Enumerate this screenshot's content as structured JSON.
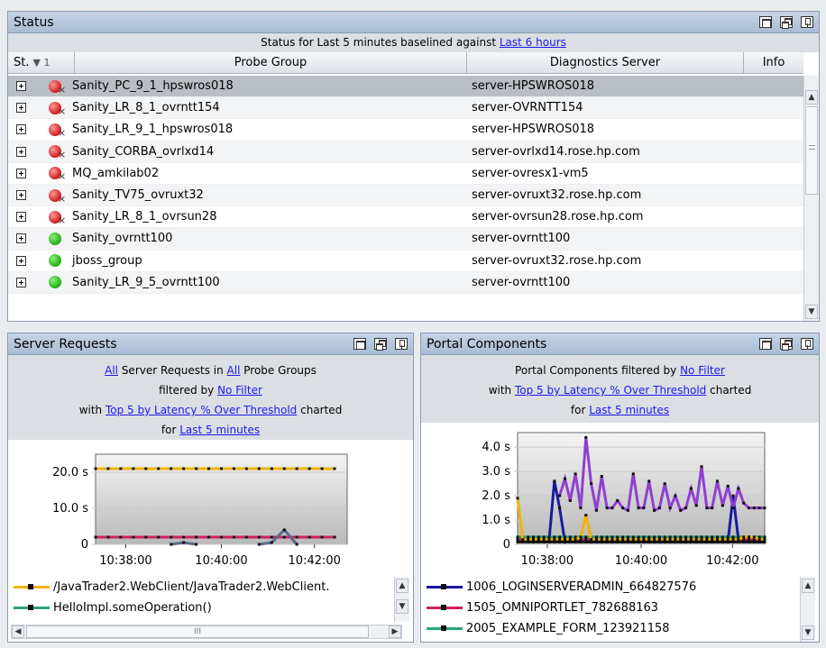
{
  "status_panel": {
    "title": "Status",
    "banner_prefix": "Status for Last 5 minutes baselined against ",
    "banner_link": "Last 6 hours",
    "columns": {
      "st": "St.",
      "sort_indicator": "▼ 1",
      "probe_group": "Probe Group",
      "server": "Diagnostics Server",
      "info": "Info"
    },
    "rows": [
      {
        "status": "red",
        "probe_group": "Sanity_PC_9_1_hpswros018",
        "server": "server-HPSWROS018",
        "selected": true
      },
      {
        "status": "red",
        "probe_group": "Sanity_LR_8_1_ovrntt154",
        "server": "server-OVRNTT154"
      },
      {
        "status": "red",
        "probe_group": "Sanity_LR_9_1_hpswros018",
        "server": "server-HPSWROS018"
      },
      {
        "status": "red",
        "probe_group": "Sanity_CORBA_ovrlxd14",
        "server": "server-ovrlxd14.rose.hp.com"
      },
      {
        "status": "red",
        "probe_group": "MQ_amkilab02",
        "server": "server-ovresx1-vm5"
      },
      {
        "status": "red",
        "probe_group": "Sanity_TV75_ovruxt32",
        "server": "server-ovruxt32.rose.hp.com"
      },
      {
        "status": "red",
        "probe_group": "Sanity_LR_8_1_ovrsun28",
        "server": "server-ovrsun28.rose.hp.com"
      },
      {
        "status": "green",
        "probe_group": "Sanity_ovrntt100",
        "server": "server-ovrntt100"
      },
      {
        "status": "green",
        "probe_group": "jboss_group",
        "server": "server-ovruxt32.rose.hp.com"
      },
      {
        "status": "green",
        "probe_group": "Sanity_LR_9_5_ovrntt100",
        "server": "server-ovrntt100"
      }
    ]
  },
  "server_requests": {
    "title": "Server Requests",
    "line1": {
      "link1": "All",
      "text1": " Server Requests in ",
      "link2": "All",
      "text2": " Probe Groups"
    },
    "line2": {
      "text": "filtered by ",
      "link": "No Filter"
    },
    "line3": {
      "text1": "with ",
      "link": "Top 5 by Latency % Over Threshold",
      "text2": " charted"
    },
    "line4": {
      "text": "for ",
      "link": "Last 5 minutes"
    },
    "legend": [
      {
        "label": "/JavaTrader2.WebClient/JavaTrader2.WebClient.",
        "color": "#f0b400"
      },
      {
        "label": "HelloImpl.someOperation()",
        "color": "#2aa37a"
      }
    ],
    "hscroll_grip": "III"
  },
  "portal_components": {
    "title": "Portal Components",
    "line1": {
      "text": "Portal Components filtered by ",
      "link": "No Filter"
    },
    "line2": {
      "text1": "with ",
      "link": "Top 5 by Latency % Over Threshold",
      "text2": " charted"
    },
    "line3": {
      "text": "for ",
      "link": "Last 5 minutes"
    },
    "legend": [
      {
        "label": "1006_LOGINSERVERADMIN_664827576",
        "color": "#1a1aa0"
      },
      {
        "label": "1505_OMNIPORTLET_782688163",
        "color": "#d02060"
      },
      {
        "label": "2005_EXAMPLE_FORM_123921158",
        "color": "#2aa37a"
      }
    ]
  },
  "chart_data": [
    {
      "type": "line",
      "name": "Server Requests",
      "x_ticks": [
        "10:38:00",
        "10:40:00",
        "10:42:00"
      ],
      "y_ticks": [
        "0",
        "10.0 s",
        "20.0 s"
      ],
      "ylim": [
        0,
        25
      ],
      "xlim": [
        0,
        20
      ],
      "series": [
        {
          "name": "/JavaTrader2.WebClient/JavaTrader2.WebClient.",
          "color": "#f0b400",
          "values": [
            21,
            21,
            21,
            21,
            21,
            21,
            21,
            21,
            21,
            21,
            21,
            21,
            21,
            21,
            21,
            21,
            21,
            21,
            21,
            21
          ]
        },
        {
          "name": "HelloImpl.someOperation()",
          "color": "#2aa37a",
          "values": [
            2,
            2,
            2,
            2,
            2,
            2,
            2,
            2,
            2,
            2,
            2,
            2,
            2,
            2,
            2,
            2,
            2,
            2,
            2,
            2
          ]
        },
        {
          "color": "#d02060",
          "values": [
            2,
            2,
            2,
            2,
            2,
            2,
            2,
            2,
            2,
            2,
            2,
            2,
            2,
            2,
            2,
            2,
            2,
            2,
            2,
            2
          ]
        },
        {
          "color": "#5a6a8a",
          "values": [
            null,
            null,
            null,
            null,
            null,
            null,
            0,
            0.5,
            0,
            null,
            null,
            null,
            null,
            0,
            0.5,
            4,
            0,
            null,
            null,
            null
          ]
        }
      ]
    },
    {
      "type": "line",
      "name": "Portal Components",
      "x_ticks": [
        "10:38:00",
        "10:40:00",
        "10:42:00"
      ],
      "y_ticks": [
        "0",
        "1.0 s",
        "2.0 s",
        "3.0 s",
        "4.0 s"
      ],
      "ylim": [
        0,
        4.6
      ],
      "xlim": [
        0,
        47
      ],
      "series": [
        {
          "name": "1006_LOGINSERVERADMIN_664827576",
          "color": "#1a1aa0",
          "values": [
            0.2,
            0.2,
            0.2,
            0.1,
            0.2,
            0.2,
            0.2,
            2.6,
            1.5,
            0.1,
            0.2,
            0.1,
            0.2,
            0.1,
            0.1,
            0.1,
            0.1,
            0.1,
            0.1,
            0.1,
            0.1,
            0.1,
            0.1,
            0.1,
            0.1,
            0.1,
            0.1,
            0.1,
            0.1,
            0.1,
            0.1,
            0.1,
            0.1,
            0.1,
            0.1,
            0.1,
            0.1,
            0.1,
            0.1,
            0.1,
            0.1,
            2.0,
            0.2,
            0.1,
            0.1,
            0.1,
            0.1,
            0.1
          ]
        },
        {
          "name": "1505_OMNIPORTLET_782688163",
          "color": "#d02060",
          "values": [
            0.2,
            0.2,
            0.2,
            0.2,
            0.2,
            0.2,
            0.2,
            0.2,
            0.2,
            0.2,
            0.2,
            0.2,
            0.2,
            0.2,
            0.2,
            0.2,
            0.2,
            0.2,
            0.2,
            0.2,
            0.2,
            0.2,
            0.2,
            0.2,
            0.2,
            0.2,
            0.2,
            0.2,
            0.2,
            0.2,
            0.2,
            0.2,
            0.2,
            0.2,
            0.2,
            0.2,
            0.2,
            0.2,
            0.2,
            0.2,
            0.2,
            0.2,
            0.2,
            0.2,
            0.2,
            0.2,
            0.2,
            0.2
          ]
        },
        {
          "name": "2005_EXAMPLE_FORM_123921158",
          "color": "#2aa37a",
          "values": [
            0.3,
            0.3,
            0.3,
            0.3,
            0.3,
            0.3,
            0.3,
            0.3,
            0.3,
            0.3,
            0.3,
            0.3,
            0.3,
            0.3,
            0.3,
            0.3,
            0.3,
            0.3,
            0.3,
            0.3,
            0.3,
            0.3,
            0.3,
            0.3,
            0.3,
            0.3,
            0.3,
            0.3,
            0.3,
            0.3,
            0.3,
            0.3,
            0.3,
            0.3,
            0.3,
            0.3,
            0.3,
            0.3,
            0.3,
            0.3,
            0.3,
            0.3,
            0.3,
            0.3,
            0.3,
            0.3,
            0.3,
            0.3
          ]
        },
        {
          "color": "#9040d0",
          "values": [
            null,
            null,
            null,
            null,
            null,
            null,
            null,
            null,
            2.0,
            2.7,
            1.8,
            2.9,
            1.5,
            4.4,
            2.5,
            1.4,
            2.8,
            1.5,
            1.5,
            1.8,
            1.5,
            1.4,
            2.9,
            1.5,
            1.5,
            2.6,
            1.4,
            1.5,
            2.5,
            1.5,
            2.0,
            1.4,
            1.5,
            2.3,
            1.6,
            3.2,
            1.5,
            1.5,
            2.6,
            1.6,
            2.4,
            1.5,
            2.3,
            1.7,
            1.5,
            1.5,
            1.5,
            1.5
          ]
        },
        {
          "color": "#f0b400",
          "values": [
            1.9,
            0.2,
            0.2,
            0.2,
            0.2,
            0.2,
            0.2,
            0.2,
            0.2,
            0.2,
            0.2,
            0.2,
            0.3,
            1.2,
            0.2,
            0.2,
            0.2,
            0.2,
            0.2,
            0.2,
            0.2,
            0.2,
            0.2,
            0.2,
            0.2,
            0.2,
            0.2,
            0.2,
            0.2,
            0.2,
            0.2,
            0.2,
            0.2,
            0.2,
            0.2,
            0.2,
            0.2,
            0.2,
            0.2,
            0.2,
            0.2,
            0.2,
            0.2,
            0.3,
            0.3,
            0.3,
            0.2,
            0.2
          ]
        },
        {
          "color": "#111111",
          "values": [
            0.1,
            0.1,
            0.1,
            0.1,
            0.1,
            0.1,
            0.1,
            0.1,
            0.1,
            0.1,
            0.1,
            0.1,
            0.1,
            0.1,
            0.1,
            0.1,
            0.1,
            0.1,
            0.1,
            0.1,
            0.1,
            0.1,
            0.1,
            0.1,
            0.1,
            0.1,
            0.1,
            0.1,
            0.1,
            0.1,
            0.1,
            0.1,
            0.1,
            0.1,
            0.1,
            0.1,
            0.1,
            0.1,
            0.1,
            0.1,
            0.1,
            0.1,
            0.1,
            0.1,
            0.1,
            0.1,
            0.1,
            0.1
          ]
        }
      ]
    }
  ]
}
